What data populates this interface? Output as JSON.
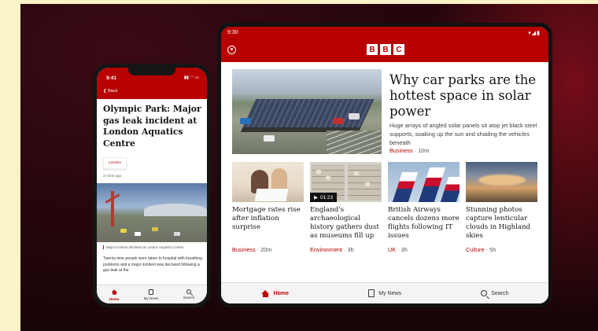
{
  "tablet": {
    "status_time": "9:30",
    "status_icons": "▾◢▮",
    "logo_letters": [
      "B",
      "B",
      "C"
    ],
    "hero": {
      "title": "Why car parks are the hottest space in solar power",
      "description": "Huge arrays of angled solar panels sit atop jet black steel supports, soaking up the sun and shading the vehicles beneath",
      "section": "Business",
      "time": "10m"
    },
    "cards": [
      {
        "title": "Mortgage rates rise after inflation surprise",
        "section": "Business",
        "time": "20m"
      },
      {
        "title": "England's archaeological history gathers dust as museums fill up",
        "section": "Environment",
        "time": "3h",
        "video_duration": "01:23"
      },
      {
        "title": "British Airways cancels dozens more flights following IT issues",
        "section": "UK",
        "time": "3h"
      },
      {
        "title": "Stunning photos capture lenticular clouds in Highland skies",
        "section": "Culture",
        "time": "5h"
      }
    ],
    "nav": {
      "home": "Home",
      "my_news": "My News",
      "search": "Search"
    },
    "meta_separator": "·"
  },
  "phone": {
    "status_time": "9:41",
    "status_icons": "▮▮ ◠ ▭",
    "back_label": "Back",
    "title": "Olympic Park: Major gas leak incident at London Aquatics Centre",
    "tag": "London",
    "time_ago": "2 mins ago",
    "caption": "Major incident declared at London Aquatics Centre",
    "body": "Twenty-nine people were taken to hospital with breathing problems and a major incident was declared following a gas leak at the",
    "nav": {
      "home": "Home",
      "my_news": "My News",
      "search": "Search"
    }
  },
  "colors": {
    "brand_red": "#b80000",
    "background_page": "#fbf3c8",
    "background_stage": "#24060c"
  },
  "icons": [
    "account-icon",
    "home-icon",
    "my-news-icon",
    "search-icon",
    "back-chevron-icon",
    "play-icon"
  ]
}
